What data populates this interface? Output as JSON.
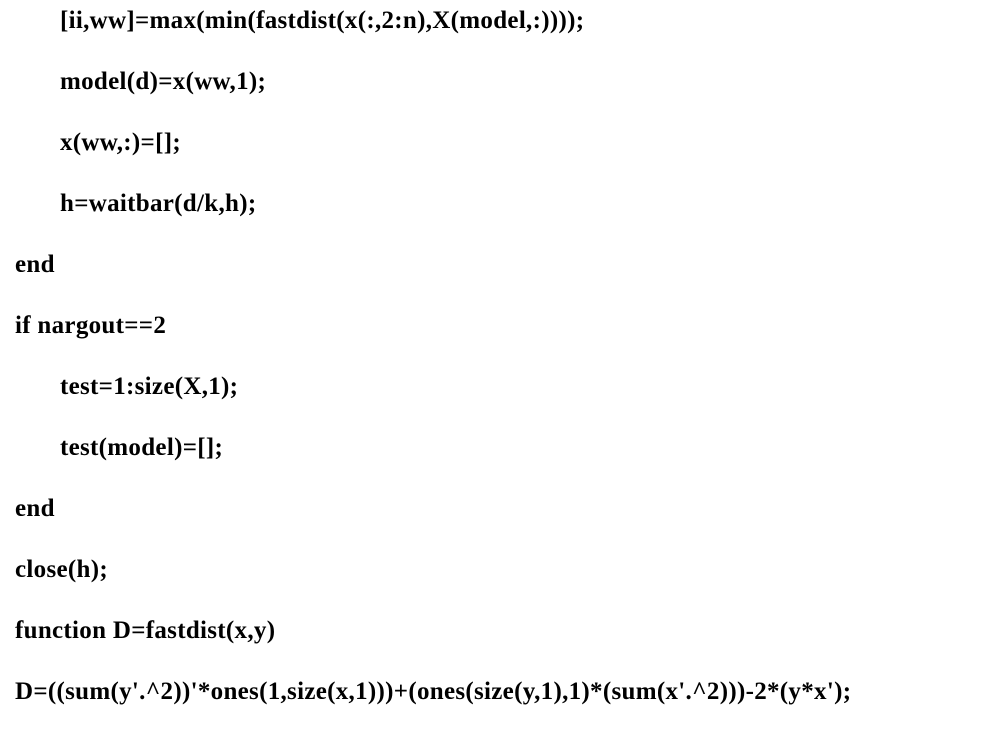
{
  "lines": {
    "l1": "[ii,ww]=max(min(fastdist(x(:,2:n),X(model,:))));",
    "l2": "model(d)=x(ww,1);",
    "l3": "x(ww,:)=[];",
    "l4": "h=waitbar(d/k,h);",
    "l5": "end",
    "l6": "if nargout==2",
    "l7": "test=1:size(X,1);",
    "l8": "test(model)=[];",
    "l9": "end",
    "l10": "close(h);",
    "l11": "function D=fastdist(x,y)",
    "l12": "D=((sum(y'.^2))'*ones(1,size(x,1)))+(ones(size(y,1),1)*(sum(x'.^2)))-2*(y*x');"
  }
}
